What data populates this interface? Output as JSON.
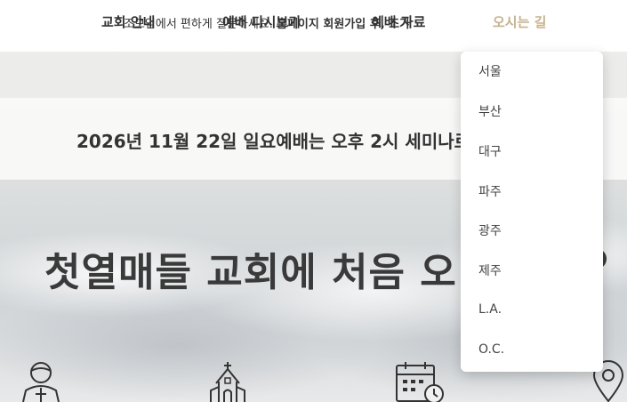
{
  "nav": {
    "items": [
      {
        "label": "교회 안내"
      },
      {
        "label": "예배 다시보기"
      },
      {
        "label": "예배 자료"
      },
      {
        "label": "오시는 길"
      }
    ],
    "active_color": "#c9b18a"
  },
  "notice": {
    "text_plain": "조모임에서 편하게 질문하세요. ",
    "text_bold": "홈페이지 회원가입 후, 조가"
  },
  "event": {
    "text": "2026년 11월 22일 일요예배는 오후 2시 세미나로"
  },
  "hero": {
    "title": "첫열매들 교회에 처음 오"
  },
  "icons": [
    "person-icon",
    "church-icon",
    "calendar-icon",
    "location-pin-icon"
  ],
  "dropdown": {
    "items": [
      "서울",
      "부산",
      "대구",
      "파주",
      "광주",
      "제주",
      "L.A.",
      "O.C."
    ]
  }
}
